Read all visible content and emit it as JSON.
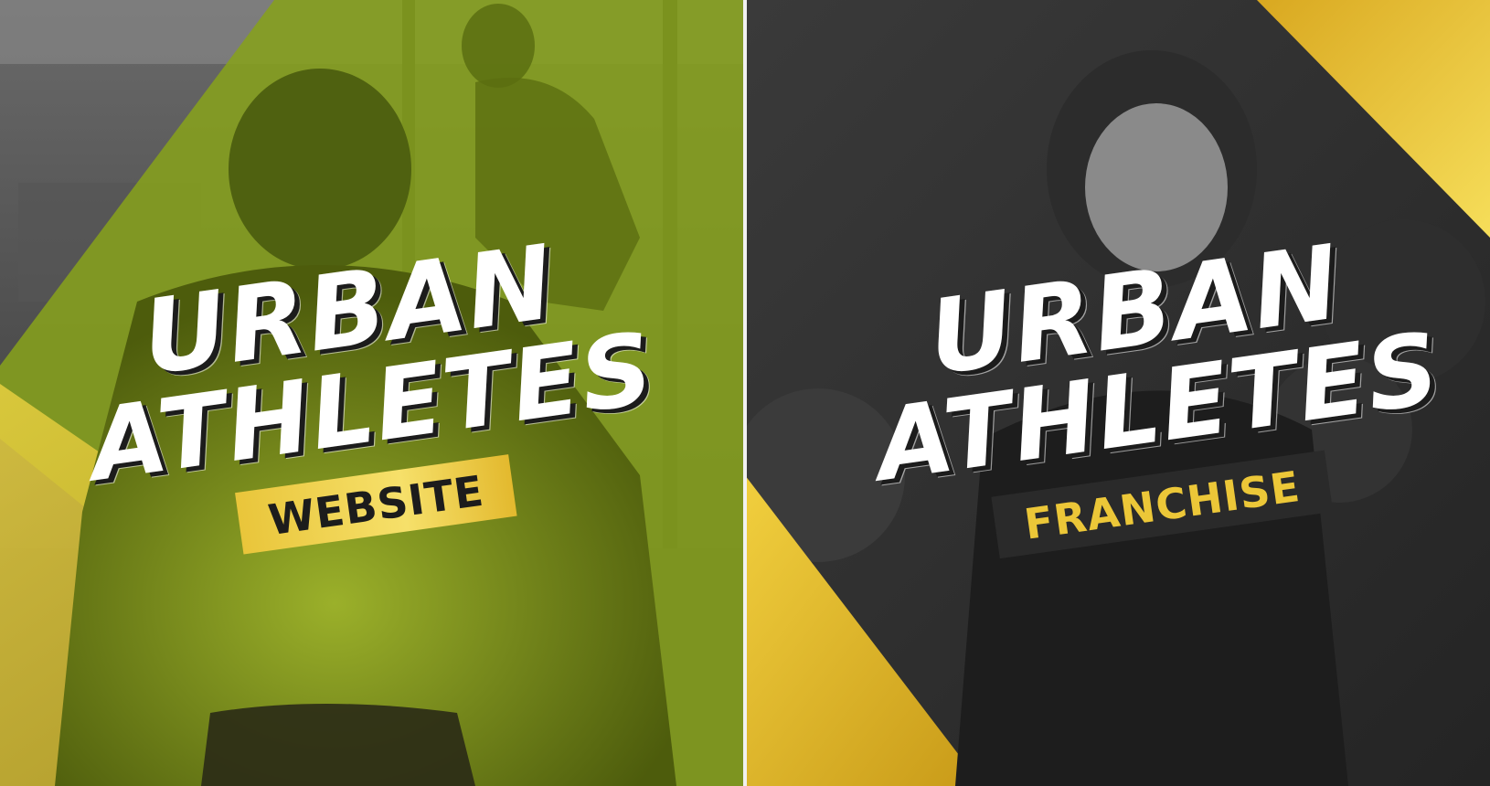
{
  "panels": [
    {
      "title_line1": "URBAN",
      "title_line2": "ATHLETES",
      "tag": "WEBSITE"
    },
    {
      "title_line1": "URBAN",
      "title_line2": "ATHLETES",
      "tag": "FRANCHISE"
    }
  ],
  "colors": {
    "green_overlay": "#7f9a16",
    "yellow_accent": "#ecc738",
    "dark_background": "#2b2b2b",
    "title_text": "#ffffff"
  }
}
